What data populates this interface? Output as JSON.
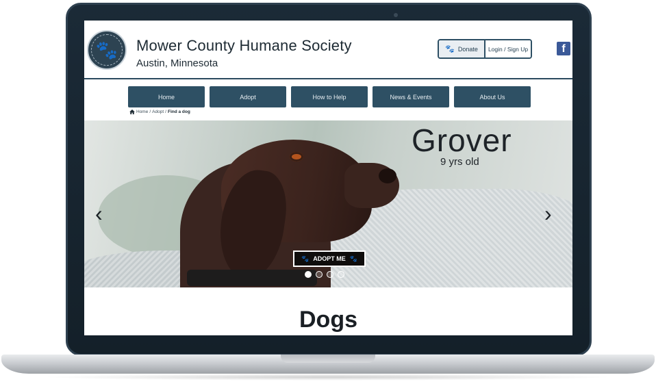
{
  "header": {
    "org_name": "Mower County Humane Society",
    "org_location": "Austin, Minnesota",
    "donate_label": "Donate",
    "login_label": "Login / Sign Up",
    "facebook_glyph": "f"
  },
  "nav": {
    "items": [
      "Home",
      "Adopt",
      "How to Help",
      "News & Events",
      "About Us"
    ]
  },
  "breadcrumb": {
    "home": "Home",
    "sep1": "/",
    "adopt": "Adopt",
    "sep2": "/",
    "current": "Find a dog"
  },
  "hero": {
    "pet_name": "Grover",
    "pet_age": "9 yrs old",
    "adopt_label": "ADOPT ME",
    "slides": 4,
    "active_slide": 1
  },
  "section": {
    "title": "Dogs"
  },
  "colors": {
    "brand": "#2e5064",
    "facebook": "#3b5998"
  },
  "icons": [
    "paw-icon",
    "home-icon",
    "chevron-left-icon",
    "chevron-right-icon",
    "facebook-icon"
  ]
}
